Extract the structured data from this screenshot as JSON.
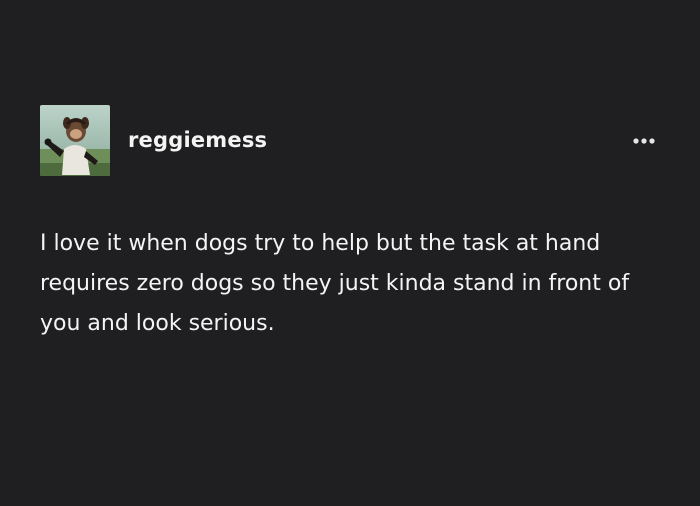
{
  "post": {
    "username": "reggiemess",
    "body": "I love it when dogs try to help but the task at hand requires zero dogs so they just kinda stand in front of you and look serious."
  },
  "icons": {
    "avatar": "avatar-image",
    "more": "ellipsis-icon"
  },
  "colors": {
    "background": "#1f1f21",
    "text": "#f4f4f4"
  }
}
